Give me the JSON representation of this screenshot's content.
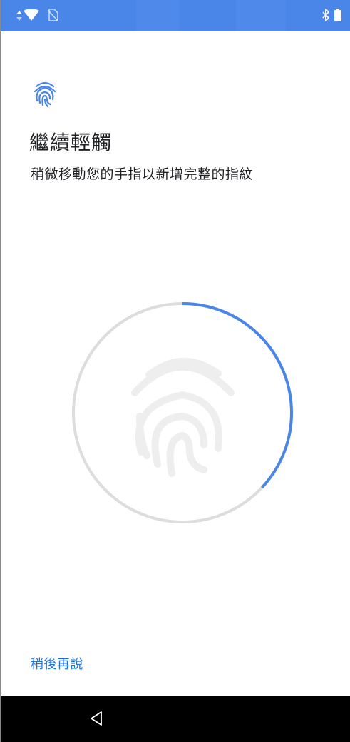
{
  "status_bar": {
    "left_icons": [
      "data-arrows-icon",
      "wifi-icon",
      "no-sim-icon"
    ],
    "right_icons": [
      "bluetooth-icon",
      "battery-icon"
    ],
    "colors": {
      "background": "#4a86e8",
      "icons": "#ffffff"
    }
  },
  "header": {
    "icon": "fingerprint-icon",
    "title": "繼續輕觸",
    "subtitle": "稍微移動您的手指以新增完整的指紋"
  },
  "enrollment": {
    "progress": 0.37,
    "icon": "fingerprint-icon",
    "colors": {
      "progress": "#4a86e8",
      "track": "#dddddd",
      "fingerprint": "#eeeeee"
    }
  },
  "footer": {
    "skip_label": "稍後再說",
    "accent": "#1a73e8"
  },
  "nav_bar": {
    "back_icon": "back-triangle-icon"
  }
}
